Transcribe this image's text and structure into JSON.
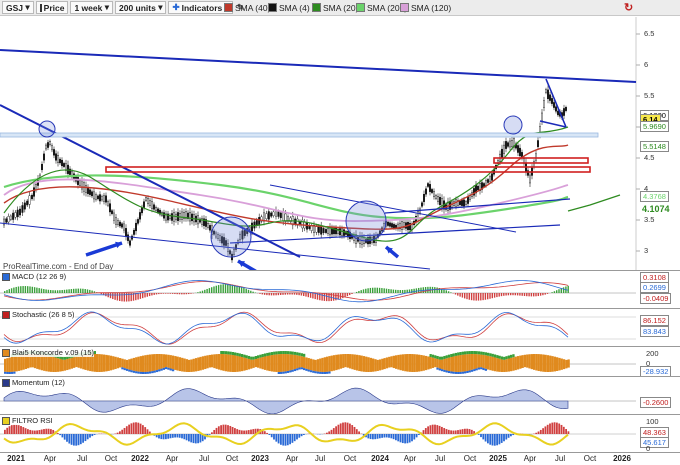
{
  "toolbar": {
    "symbol": "GSJ",
    "price_label": "Price",
    "timeframe": "1 week",
    "units": "200 units",
    "indicators_label": "Indicators",
    "legend": [
      {
        "label": "SMA (40)",
        "color": "#c0392b"
      },
      {
        "label": "SMA (4)",
        "color": "#111111"
      },
      {
        "label": "SMA (20)",
        "color": "#2e8b20"
      },
      {
        "label": "SMA (200)",
        "color": "#6bd36b"
      },
      {
        "label": "SMA (120)",
        "color": "#d9a0d9"
      }
    ]
  },
  "price_axis": {
    "ticks": [
      "8",
      "7.5",
      "7",
      "6.5",
      "6",
      "5.5",
      "5",
      "4.5",
      "4",
      "3.5",
      "3"
    ],
    "badges": [
      {
        "label": "6.1800",
        "color": "#000000"
      },
      {
        "label": "6.14",
        "color": "#000000"
      },
      {
        "label": "5.9690",
        "color": "#2e8b20"
      },
      {
        "label": "5.5148",
        "color": "#2e8b20"
      },
      {
        "label": "4.3768",
        "color": "#6bd36b"
      },
      {
        "label": "4.1074",
        "color": "#2e8b20"
      }
    ]
  },
  "watermark": "ProRealTime.com - End of Day",
  "panels": {
    "macd": {
      "label": "MACD (12 26 9)",
      "ticks": [
        "0.3108",
        "0.2699",
        "-0.0409"
      ]
    },
    "stochastic": {
      "label": "Stochastic (26 8 5)",
      "ticks": [
        "86.152",
        "83.843"
      ]
    },
    "koncorde": {
      "label": "Blai5 Koncorde v.09 (15)",
      "ticks": [
        "200",
        "0",
        "-28.932"
      ]
    },
    "momentum": {
      "label": "Momentum (12)",
      "ticks": [
        "-0.2600"
      ]
    },
    "filtro": {
      "label": "FILTRO RSI",
      "ticks": [
        "100",
        "48.363",
        "45.617",
        "0"
      ]
    }
  },
  "x_axis": {
    "labels": [
      "2021",
      "Apr",
      "Jul",
      "Oct",
      "2022",
      "Apr",
      "Jul",
      "Oct",
      "2023",
      "Apr",
      "Jul",
      "Oct",
      "2024",
      "Apr",
      "Jul",
      "Oct",
      "2025",
      "Apr",
      "Jul",
      "Oct",
      "2026"
    ]
  },
  "colors": {
    "trendline": "#1a2ab8",
    "resistance": "#d02020",
    "support_zone": "#9ab8e0"
  }
}
